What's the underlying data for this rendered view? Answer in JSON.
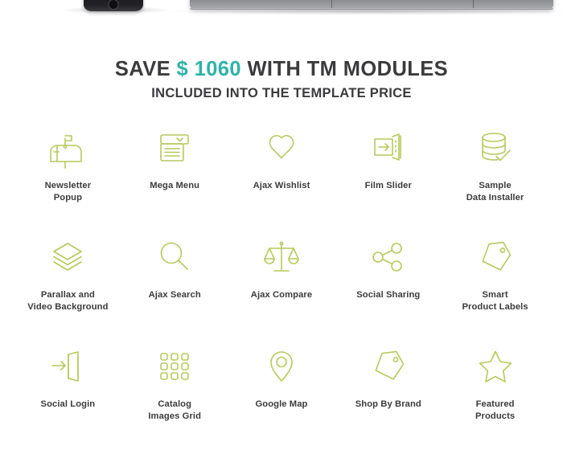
{
  "devices": {
    "phone_name": "smartphone-bottom-edge",
    "tablet_name": "tablet-bottom-edge"
  },
  "heading": {
    "prefix": "SAVE ",
    "accent": "$ 1060",
    "suffix": " WITH TM MODULES",
    "subtitle": "INCLUDED INTO THE TEMPLATE PRICE"
  },
  "colors": {
    "accent_teal": "#2fb3a8",
    "icon_green": "#b6c95c",
    "text_dark": "#3b3b3d",
    "background": "#ffffff"
  },
  "features": [
    {
      "label": "Newsletter\nPopup",
      "icon": "mailbox-icon"
    },
    {
      "label": "Mega Menu",
      "icon": "dropdown-menu-icon"
    },
    {
      "label": "Ajax Wishlist",
      "icon": "heart-icon"
    },
    {
      "label": "Film Slider",
      "icon": "slider-arrow-icon"
    },
    {
      "label": "Sample\nData Installer",
      "icon": "database-check-icon"
    },
    {
      "label": "Parallax and\nVideo Background",
      "icon": "layers-icon"
    },
    {
      "label": "Ajax Search",
      "icon": "magnifier-icon"
    },
    {
      "label": "Ajax Compare",
      "icon": "balance-scales-icon"
    },
    {
      "label": "Social Sharing",
      "icon": "share-nodes-icon"
    },
    {
      "label": "Smart\nProduct Labels",
      "icon": "price-tag-icon"
    },
    {
      "label": "Social Login",
      "icon": "login-door-icon"
    },
    {
      "label": "Catalog\nImages Grid",
      "icon": "grid-squares-icon"
    },
    {
      "label": "Google Map",
      "icon": "map-pin-icon"
    },
    {
      "label": "Shop By Brand",
      "icon": "tag-icon"
    },
    {
      "label": "Featured\nProducts",
      "icon": "star-icon"
    }
  ]
}
